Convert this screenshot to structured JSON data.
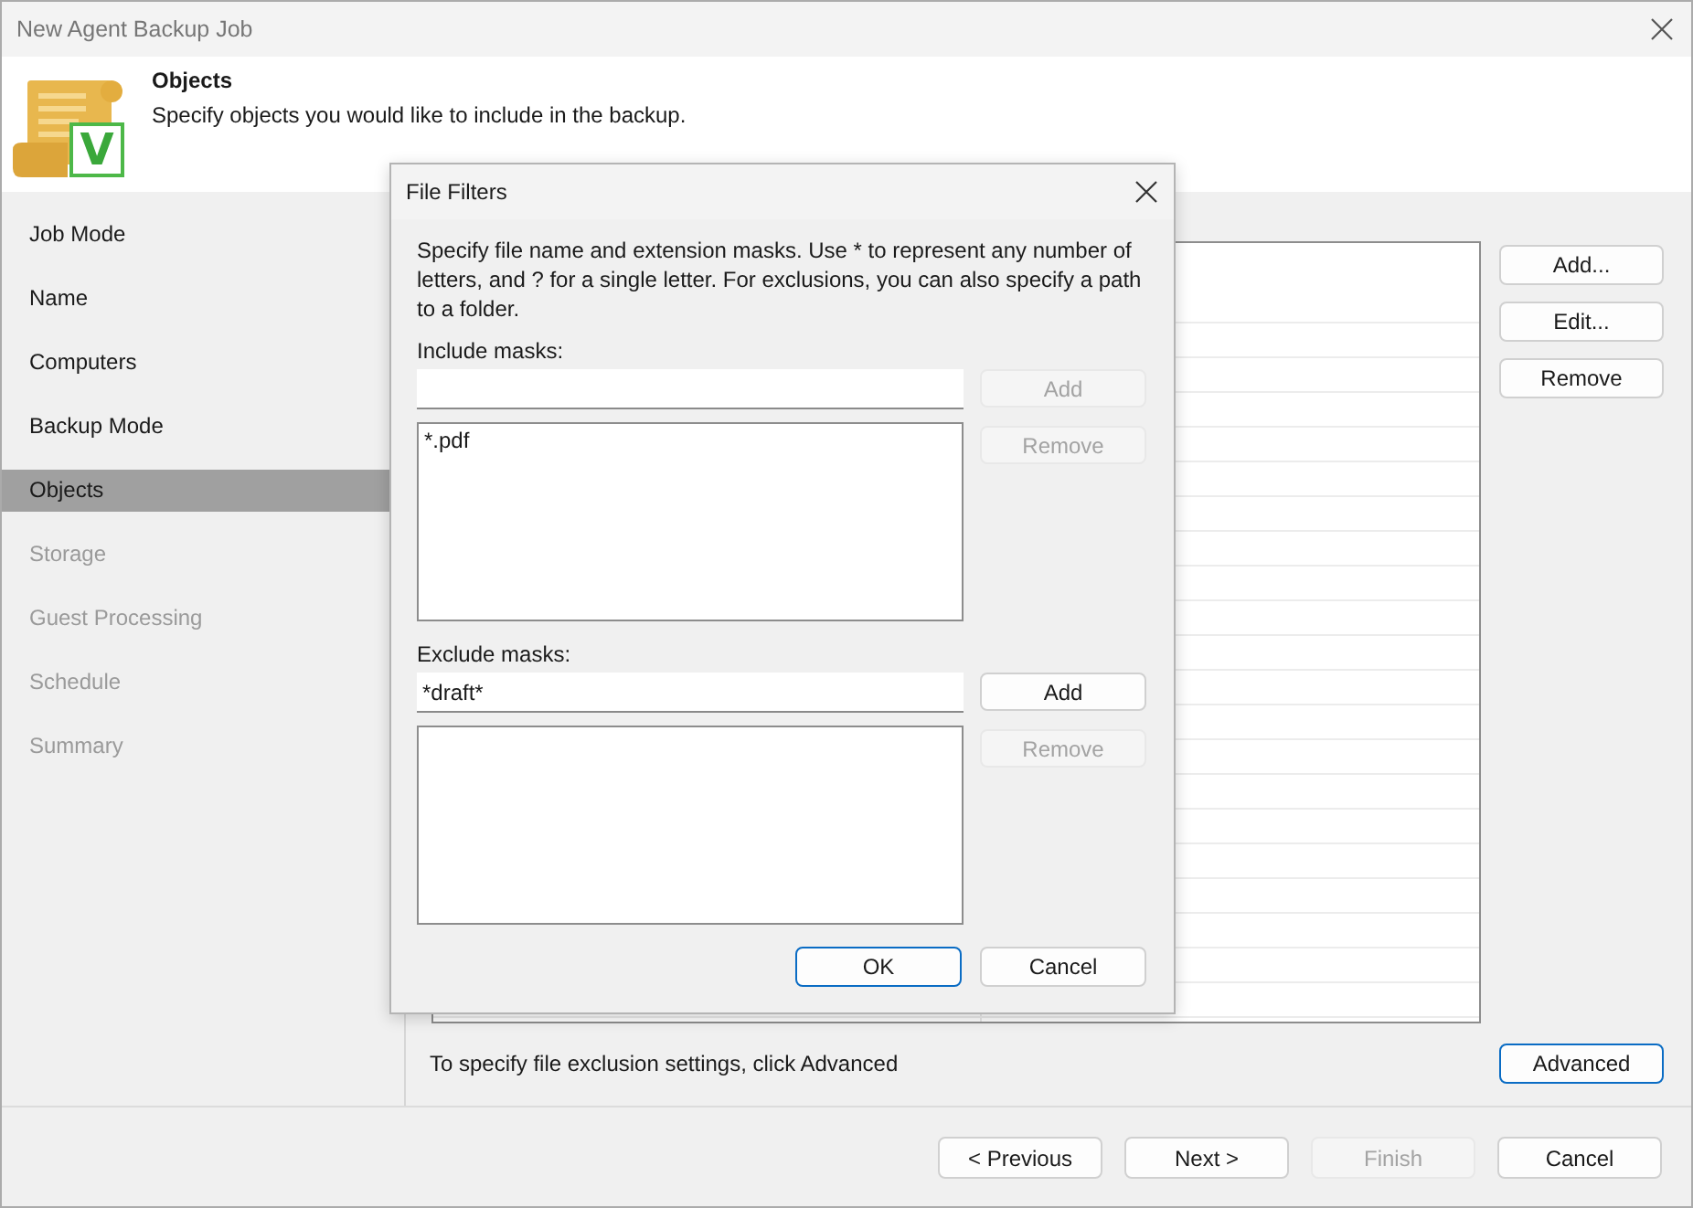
{
  "window": {
    "title": "New Agent Backup Job"
  },
  "header": {
    "title": "Objects",
    "subtitle": "Specify objects you would like to include in the backup.",
    "logo_letter": "V"
  },
  "steps": [
    {
      "label": "Job Mode",
      "selected": false,
      "disabled": false
    },
    {
      "label": "Name",
      "selected": false,
      "disabled": false
    },
    {
      "label": "Computers",
      "selected": false,
      "disabled": false
    },
    {
      "label": "Backup Mode",
      "selected": false,
      "disabled": false
    },
    {
      "label": "Objects",
      "selected": true,
      "disabled": false
    },
    {
      "label": "Storage",
      "selected": false,
      "disabled": true
    },
    {
      "label": "Guest Processing",
      "selected": false,
      "disabled": true
    },
    {
      "label": "Schedule",
      "selected": false,
      "disabled": true
    },
    {
      "label": "Summary",
      "selected": false,
      "disabled": true
    }
  ],
  "objects": {
    "buttons": [
      {
        "label": "Add..."
      },
      {
        "label": "Edit..."
      },
      {
        "label": "Remove"
      }
    ],
    "hint": "To specify file exclusion settings, click Advanced",
    "advanced_button": {
      "label": "Advanced",
      "default": true
    }
  },
  "footer_buttons": [
    {
      "label": "< Previous",
      "disabled": false
    },
    {
      "label": "Next >",
      "disabled": false
    },
    {
      "label": "Finish",
      "disabled": true
    },
    {
      "label": "Cancel",
      "disabled": false
    }
  ],
  "dialog": {
    "title": "File Filters",
    "description": "Specify file name and extension masks. Use * to represent any number of letters, and ? for a single letter. For exclusions, you can also specify a path to a folder.",
    "sections": [
      {
        "label": "Include masks:",
        "add_button": {
          "label": "Add",
          "disabled": true
        },
        "items": [
          "*.pdf"
        ],
        "remove_button": {
          "label": "Remove",
          "disabled": true
        }
      },
      {
        "label": "Exclude masks:",
        "value": "*draft*",
        "add_button": {
          "label": "Add",
          "disabled": false
        },
        "remove_button": {
          "label": "Remove",
          "disabled": true
        }
      }
    ],
    "buttons": [
      {
        "label": "OK",
        "default": true
      },
      {
        "label": "Cancel",
        "default": false
      }
    ]
  }
}
